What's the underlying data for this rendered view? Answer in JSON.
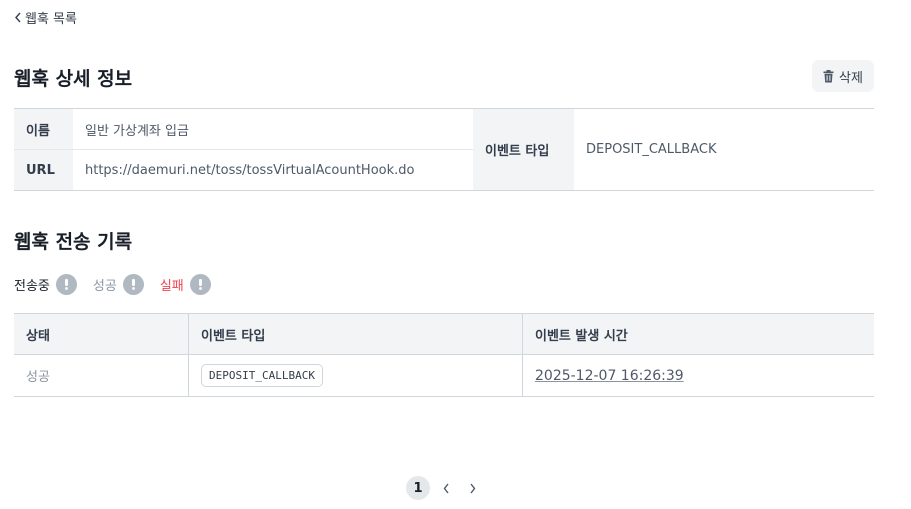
{
  "nav": {
    "back_label": "웹훅 목록"
  },
  "detail": {
    "title": "웹훅 상세 정보",
    "delete_label": "삭제",
    "name_label": "이름",
    "name_value": "일반 가상계좌 입금",
    "url_label": "URL",
    "url_value": "https://daemuri.net/toss/tossVirtualAcountHook.do",
    "event_type_label": "이벤트 타입",
    "event_type_value": "DEPOSIT_CALLBACK"
  },
  "history": {
    "title": "웹훅 전송 기록",
    "filters": [
      {
        "label": "전송중",
        "color": "#191f28"
      },
      {
        "label": "성공",
        "color": "#8b95a1"
      },
      {
        "label": "실패",
        "color": "#f04452"
      }
    ],
    "columns": [
      "상태",
      "이벤트 타입",
      "이벤트 발생 시간"
    ],
    "rows": [
      {
        "status": "성공",
        "event_type": "DEPOSIT_CALLBACK",
        "time": "2025-12-07 16:26:39"
      }
    ]
  },
  "pagination": {
    "current_page": "1"
  }
}
